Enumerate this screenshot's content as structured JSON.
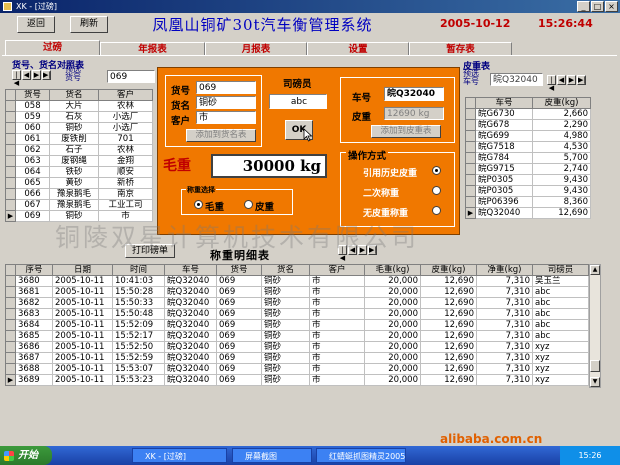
{
  "window": {
    "title": "XK - [过磅]"
  },
  "toolbar": {
    "back_label": "返回",
    "refresh_label": "刷新"
  },
  "header": {
    "title": "凤凰山铜矿30t汽车衡管理系统",
    "date": "2005-10-12",
    "time": "15:26:44"
  },
  "tabs": [
    {
      "label": "过磅",
      "active": true
    },
    {
      "label": "年报表"
    },
    {
      "label": "月报表"
    },
    {
      "label": "设置"
    },
    {
      "label": "暂存表"
    }
  ],
  "goods_table": {
    "title": "货号、货名对照表",
    "preselect_label": "预选\n货号",
    "preselect_value": "069",
    "columns": [
      "货号",
      "货名",
      "客户"
    ],
    "rows": [
      [
        "058",
        "大片",
        "农林"
      ],
      [
        "059",
        "石灰",
        "小选厂"
      ],
      [
        "060",
        "铜砂",
        "小选厂"
      ],
      [
        "061",
        "废铁削",
        "701"
      ],
      [
        "062",
        "石子",
        "农林"
      ],
      [
        "063",
        "废钢绳",
        "金翔"
      ],
      [
        "064",
        "铁砂",
        "顺安"
      ],
      [
        "065",
        "黄砂",
        "新桥"
      ],
      [
        "066",
        "豫泉鹅毛",
        "南京"
      ],
      [
        "067",
        "豫泉鹅毛",
        "工业工司"
      ],
      [
        "069",
        "铜砂",
        "市"
      ]
    ],
    "selected_index": 10
  },
  "weigh_form": {
    "goods_no_label": "货号",
    "goods_no": "069",
    "goods_name_label": "货名",
    "goods_name": "铜砂",
    "customer_label": "客户",
    "customer": "市",
    "add_goods_button": "添加到货名表",
    "operator_label": "司磅员",
    "operator": "abc",
    "ok_button": "OK",
    "plate_label": "车号",
    "plate": "皖Q32040",
    "tare_label": "皮重",
    "tare": "12690 kg",
    "add_tare_button": "添加到皮重表",
    "gross_label": "毛重",
    "gross": "30000 kg",
    "weigh_select_title": "称重选择",
    "weigh_gross_label": "毛重",
    "weigh_tare_label": "皮重",
    "weigh_selected": "毛重",
    "mode_title": "操作方式",
    "modes": [
      "引用历史皮重",
      "二次称重",
      "无皮重称重"
    ],
    "mode_selected": 0
  },
  "tare_table": {
    "title": "皮重表",
    "preselect_label": "预选\n车号",
    "preselect_value": "皖Q32040",
    "columns": [
      "车号",
      "皮重(kg)"
    ],
    "rows": [
      [
        "皖G6730",
        "2,660"
      ],
      [
        "皖G678",
        "2,290"
      ],
      [
        "皖G699",
        "4,980"
      ],
      [
        "皖G7518",
        "4,530"
      ],
      [
        "皖G784",
        "5,700"
      ],
      [
        "皖G9715",
        "2,740"
      ],
      [
        "皖P0305",
        "9,430"
      ],
      [
        "皖P0305",
        "9,430"
      ],
      [
        "皖P06396",
        "8,360"
      ],
      [
        "皖Q32040",
        "12,690"
      ]
    ],
    "selected_index": 9
  },
  "detail": {
    "print_button": "打印磅单",
    "title": "称重明细表",
    "columns": [
      "序号",
      "日期",
      "时间",
      "车号",
      "货号",
      "货名",
      "客户",
      "毛重(kg)",
      "皮重(kg)",
      "净重(kg)",
      "司磅员"
    ],
    "rows": [
      [
        "3680",
        "2005-10-11",
        "10:41:03",
        "皖Q32040",
        "069",
        "铜砂",
        "市",
        "20,000",
        "12,690",
        "7,310",
        "吴玉兰"
      ],
      [
        "3681",
        "2005-10-11",
        "15:50:28",
        "皖Q32040",
        "069",
        "铜砂",
        "市",
        "20,000",
        "12,690",
        "7,310",
        "abc"
      ],
      [
        "3682",
        "2005-10-11",
        "15:50:33",
        "皖Q32040",
        "069",
        "铜砂",
        "市",
        "20,000",
        "12,690",
        "7,310",
        "abc"
      ],
      [
        "3683",
        "2005-10-11",
        "15:50:48",
        "皖Q32040",
        "069",
        "铜砂",
        "市",
        "20,000",
        "12,690",
        "7,310",
        "abc"
      ],
      [
        "3684",
        "2005-10-11",
        "15:52:09",
        "皖Q32040",
        "069",
        "铜砂",
        "市",
        "20,000",
        "12,690",
        "7,310",
        "abc"
      ],
      [
        "3685",
        "2005-10-11",
        "15:52:17",
        "皖Q32040",
        "069",
        "铜砂",
        "市",
        "20,000",
        "12,690",
        "7,310",
        "abc"
      ],
      [
        "3686",
        "2005-10-11",
        "15:52:50",
        "皖Q32040",
        "069",
        "铜砂",
        "市",
        "20,000",
        "12,690",
        "7,310",
        "xyz"
      ],
      [
        "3687",
        "2005-10-11",
        "15:52:59",
        "皖Q32040",
        "069",
        "铜砂",
        "市",
        "20,000",
        "12,690",
        "7,310",
        "xyz"
      ],
      [
        "3688",
        "2005-10-11",
        "15:53:07",
        "皖Q32040",
        "069",
        "铜砂",
        "市",
        "20,000",
        "12,690",
        "7,310",
        "xyz"
      ],
      [
        "3689",
        "2005-10-11",
        "15:53:23",
        "皖Q32040",
        "069",
        "铜砂",
        "市",
        "20,000",
        "12,690",
        "7,310",
        "xyz"
      ]
    ],
    "selected_index": 9
  },
  "watermark": "铜陵双星计算机技术有限公司",
  "site_watermark": "alibaba.com.cn",
  "taskbar": {
    "start_label": "开始",
    "tasks": [
      "XK - [过磅]",
      "屏幕截图",
      "红蜻蜓抓图精灵2005"
    ],
    "clock": "15:26"
  },
  "colors": {
    "orange_panel": "#f07800",
    "title_blue": "#0000c0",
    "accent_red": "#c00000"
  }
}
